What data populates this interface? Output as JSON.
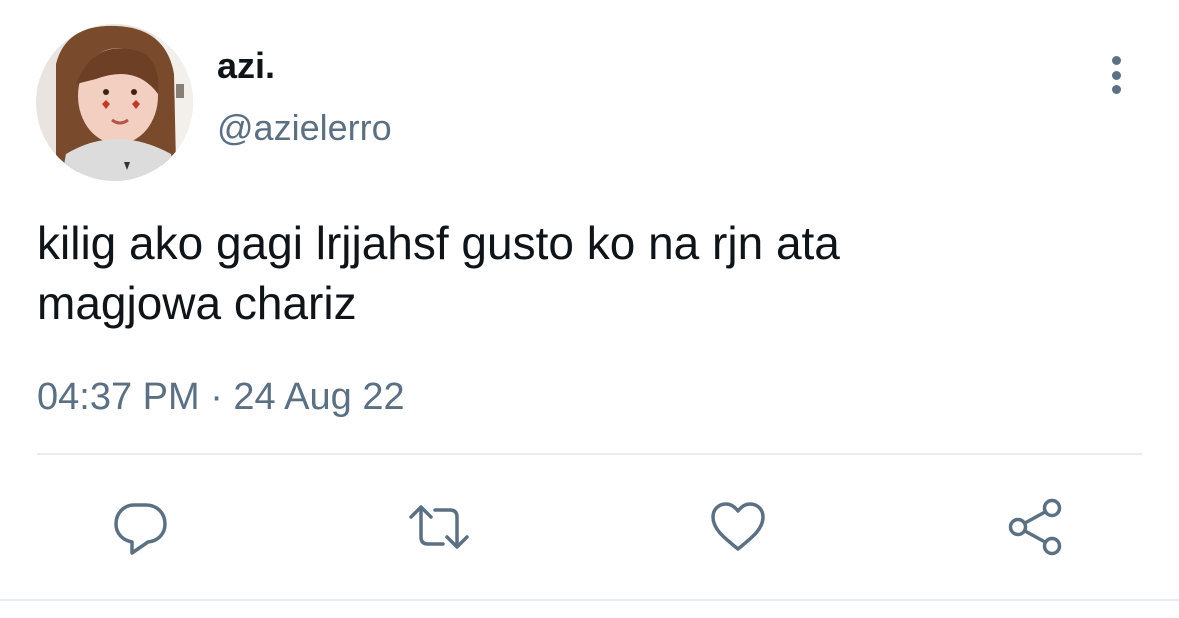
{
  "author": {
    "display_name": "azi.",
    "handle": "@azielerro"
  },
  "tweet": {
    "text": "kilig ako gagi lrjjahsf gusto ko na rjn ata\nmagjowa chariz",
    "timestamp": "04:37 PM · 24 Aug 22"
  },
  "icons": {
    "more": "more-vertical-icon",
    "reply": "reply-icon",
    "retweet": "retweet-icon",
    "like": "heart-icon",
    "share": "share-icon"
  },
  "colors": {
    "text_primary": "#0f1419",
    "text_secondary": "#5b7083",
    "divider": "#e6ecf0"
  }
}
